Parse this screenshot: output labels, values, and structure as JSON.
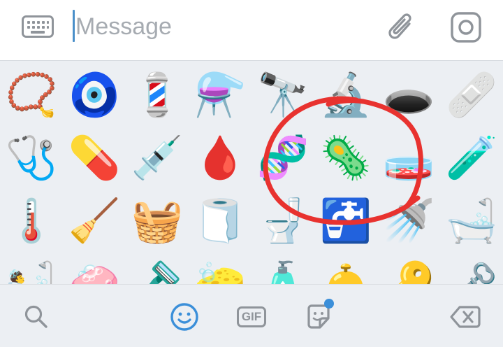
{
  "message_bar": {
    "placeholder": "Message",
    "keyboard_icon": "keyboard-icon",
    "attach_icon": "paperclip-icon",
    "camera_icon": "camera-icon"
  },
  "emoji_panel": {
    "rows": [
      [
        "📿",
        "🧿",
        "💈",
        "⚗️",
        "🔭",
        "🔬",
        "🕳️",
        "🩹"
      ],
      [
        "🩺",
        "💊",
        "💉",
        "🩸",
        "🧬",
        "🦠",
        "🧫",
        "🧪"
      ],
      [
        "🌡️",
        "🧹",
        "🧺",
        "🧻",
        "🚽",
        "🚰",
        "🚿",
        "🛁"
      ],
      [
        "🛀",
        "🧼",
        "🪒",
        "🧽",
        "🧴",
        "🛎️",
        "🔑",
        "🗝️"
      ]
    ],
    "annotation": "red hand-drawn circle around 🧬 🦠 🧫"
  },
  "bottom_bar": {
    "search_icon": "search-icon",
    "emoji_icon": "smiley-icon",
    "gif_label": "GIF",
    "sticker_icon": "sticker-icon",
    "backspace_icon": "backspace-icon"
  },
  "colors": {
    "accent": "#3b8fd9",
    "caret": "#4a8fc9",
    "annotation": "#e8322f",
    "icon_gray": "#8f949a",
    "panel_bg": "#eceff3"
  }
}
